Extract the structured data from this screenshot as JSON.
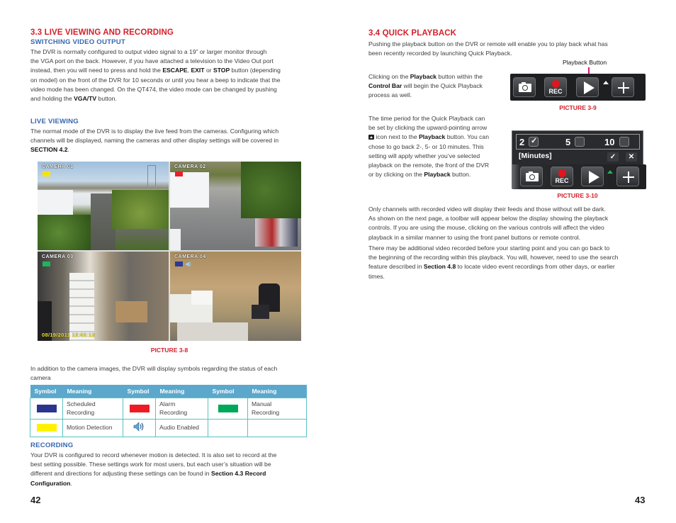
{
  "left_page": {
    "section_title": "3.3 LIVE VIEWING AND RECORDING",
    "switching": {
      "heading": "SWITCHING VIDEO OUTPUT",
      "lines": [
        "The DVR is normally configured to output video signal to a 19” or larger monitor through",
        "the VGA port on the back. However, if you have attached a television to the Video Out port",
        [
          "instead, then you will need to press and hold the ",
          "ESCAPE",
          ", ",
          "EXIT",
          " or ",
          "STOP",
          " button (depending"
        ],
        "on model) on the front of the DVR  for 10 seconds or until you hear a beep to indicate that the",
        "video mode has been changed. On the QT474, the video mode can be changed by pushing",
        [
          "and holding the ",
          "VGA/TV",
          " button."
        ]
      ],
      "line1": "The DVR is normally configured to output video signal to a 19” or larger monitor through",
      "line2": "the VGA port on the back. However, if you have attached a television to the Video Out port",
      "line3_a": "instead, then you will need to press and hold the ",
      "line3_b": "ESCAPE",
      "line3_c": ", ",
      "line3_d": "EXIT",
      "line3_e": " or ",
      "line3_f": "STOP",
      "line3_g": " button (depending",
      "line4": "on model) on the front of the DVR  for 10 seconds or until you hear a beep to indicate that the",
      "line5": "video mode has been changed. On the QT474, the video mode can be changed by pushing",
      "line6_a": "and holding the ",
      "line6_b": "VGA/TV",
      "line6_c": " button."
    },
    "live_viewing": {
      "heading": "LIVE VIEWING",
      "line1": "The normal mode of the DVR is to display the live feed from the cameras. Configuring which",
      "line2": "channels will be displayed, naming the cameras and other display settings will be covered in",
      "line3_b": "SECTION 4.2",
      "line3_c": "."
    },
    "cameras": [
      {
        "label": "CAMERA 01",
        "status_color": "#f5e400"
      },
      {
        "label": "CAMERA 02",
        "status_color": "#e8202a"
      },
      {
        "label": "CAMERA 03",
        "status_color": "#1fb35a"
      },
      {
        "label": "CAMERA 04",
        "status_color": "#2b3a96"
      }
    ],
    "timestamp": "08/19/2011  12:02:12",
    "picture_caption": "PICTURE 3-8",
    "symbols_intro_1": "In addition to the camera images, the DVR will display symbols regarding the status of each",
    "symbols_intro_2": "camera",
    "symbol_table": {
      "headers": [
        "Symbol",
        "Meaning",
        "Symbol",
        "Meaning",
        "Symbol",
        "Meaning"
      ],
      "rows": [
        [
          {
            "swatch": "#2b3590",
            "meaning_1": "Scheduled",
            "meaning_2": "Recording"
          },
          {
            "swatch": "#ed1c24",
            "meaning_1": "Alarm",
            "meaning_2": "Recording"
          },
          {
            "swatch": "#00a859",
            "meaning_1": "Manual",
            "meaning_2": "Recording"
          }
        ],
        [
          {
            "swatch": "#fff200",
            "meaning_1": "Motion Detection"
          },
          {
            "icon": "audio-speaker-icon",
            "meaning_1": "Audio Enabled"
          },
          {
            "meaning_1": ""
          }
        ]
      ]
    },
    "recording": {
      "heading": "RECORDING",
      "line1": "Your DVR is configured to record whenever motion is detected. It is also set to record at the",
      "line2": "best setting possible. These settings work for most users, but each user’s situation will be",
      "line3_a": "different and directions for adjusting these settings can be found in ",
      "line3_b": "Section 4.3 Record",
      "line4_b": "Configuration",
      "line4_c": "."
    },
    "page_number": "42"
  },
  "right_page": {
    "section_title": "3.4 QUICK PLAYBACK",
    "intro_1": "Pushing the playback button on the DVR or remote will enable you to play back what has",
    "intro_2": "been recently recorded by launching Quick Playback.",
    "playback_button_label": "Playback Button",
    "click_text": {
      "l1_a": "Clicking on the ",
      "l1_b": "Playback",
      "l1_c": " button within the",
      "l2_b": "Control Bar",
      "l2_c": " will begin the Quick Playback",
      "l3": "process as well."
    },
    "picture_3_9": "PICTURE 3-9",
    "time_text": {
      "l1": "The time period for the Quick Playback can",
      "l2": "be set by clicking the upward-pointing arrow",
      "l3_a": " icon next to the ",
      "l3_b": "Playback",
      "l3_c": " button. You can",
      "l4": "chose to go back 2-, 5- or 10 minutes. This",
      "l5": "setting will apply whether you’ve selected",
      "l6": "playback on the remote, the front of the DVR",
      "l7_a": "or by clicking on the ",
      "l7_b": "Playback",
      "l7_c": " button."
    },
    "minutes_picker": {
      "options": [
        {
          "value": "2",
          "checked": true
        },
        {
          "value": "5",
          "checked": false
        },
        {
          "value": "10",
          "checked": false
        }
      ],
      "unit_label": "[Minutes]",
      "confirm": "✓",
      "cancel": "✕"
    },
    "rec_label": "REC",
    "picture_3_10": "PICTURE 3-10",
    "para1": {
      "l1": "Only channels with recorded video will display their feeds and those without will be dark.",
      "l2": "As shown on the next page, a toolbar will appear below the display showing the playback",
      "l3": "controls. If you are using the mouse, clicking on the various controls will affect the video",
      "l4": "playback in a similar manner to using the front panel buttons or remote control."
    },
    "para2": {
      "l1": "There may be additional video recorded before your starting point and you can go back to",
      "l2": "the beginning of the recording within this playback. You will, however, need to use the search",
      "l3_a": "feature described in ",
      "l3_b": "Section 4.8",
      "l3_c": " to locate video event recordings from other days, or earlier",
      "l4": "times."
    },
    "page_number": "43"
  }
}
